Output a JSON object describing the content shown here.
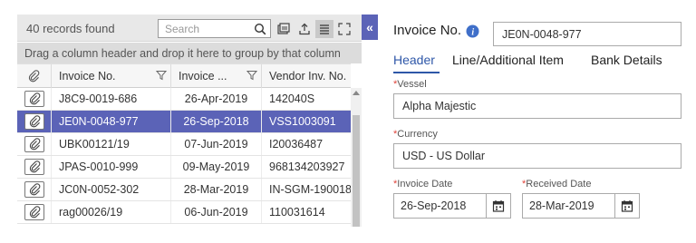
{
  "grid": {
    "records_count": "40 records found",
    "search_placeholder": "Search",
    "group_hint": "Drag a column header and drop it here to group by that column",
    "columns": {
      "invoice_no": "Invoice No.",
      "invoice_date": "Invoice ...",
      "vendor_inv_no": "Vendor Inv. No."
    },
    "rows": [
      {
        "invoice_no": "J8C9-0019-686",
        "invoice_date": "26-Apr-2019",
        "vendor_inv_no": "142040S",
        "selected": false
      },
      {
        "invoice_no": "JE0N-0048-977",
        "invoice_date": "26-Sep-2018",
        "vendor_inv_no": "VSS1003091",
        "selected": true
      },
      {
        "invoice_no": "UBK00121/19",
        "invoice_date": "07-Jun-2019",
        "vendor_inv_no": "I20036487",
        "selected": false
      },
      {
        "invoice_no": "JPAS-0010-999",
        "invoice_date": "09-May-2019",
        "vendor_inv_no": "968134203927",
        "selected": false
      },
      {
        "invoice_no": "JC0N-0052-302",
        "invoice_date": "28-Mar-2019",
        "vendor_inv_no": "IN-SGM-190018",
        "selected": false
      },
      {
        "invoice_no": "rag00026/19",
        "invoice_date": "06-Jun-2019",
        "vendor_inv_no": "110031614",
        "selected": false
      }
    ],
    "selected_color": "#5b63b7"
  },
  "collapse_tab": {
    "glyph": "«"
  },
  "form": {
    "title": "Invoice No.",
    "invoice_no_value": "JE0N-0048-977",
    "tabs": [
      "Header",
      "Line/Additional Item",
      "Bank Details"
    ],
    "vessel": {
      "label": "Vessel",
      "value": "Alpha Majestic"
    },
    "currency": {
      "label": "Currency",
      "value": "USD - US Dollar"
    },
    "invoice_date": {
      "label": "Invoice Date",
      "value": "26-Sep-2018"
    },
    "received_date": {
      "label": "Received Date",
      "value": "28-Mar-2019"
    },
    "accent_color": "#2e57a8",
    "required_mark": "*"
  }
}
